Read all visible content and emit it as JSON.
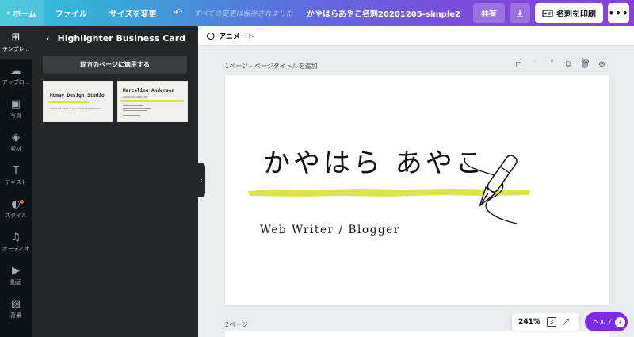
{
  "topbar": {
    "home": "ホーム",
    "file": "ファイル",
    "resize": "サイズを変更",
    "undo_icon": "undo-icon",
    "saved_status": "すべての変更は保存されました",
    "doc_name": "かやはらあやこ名刺20201205-simple2",
    "share": "共有",
    "download_icon": "download-icon",
    "print": "名刺を印刷",
    "more": "•••"
  },
  "rail": {
    "items": [
      {
        "label": "テンプレ...",
        "icon": "template-icon"
      },
      {
        "label": "アップロ...",
        "icon": "upload-icon"
      },
      {
        "label": "写真",
        "icon": "photo-icon"
      },
      {
        "label": "素材",
        "icon": "elements-icon"
      },
      {
        "label": "テキスト",
        "icon": "text-icon"
      },
      {
        "label": "スタイル",
        "icon": "style-icon"
      },
      {
        "label": "オーディオ",
        "icon": "audio-icon"
      },
      {
        "label": "動画",
        "icon": "video-icon"
      },
      {
        "label": "背景",
        "icon": "background-icon"
      }
    ]
  },
  "panel": {
    "back_icon": "back-chevron-icon",
    "title": "Highlighter Business Card",
    "apply_button": "両方のページに適用する",
    "thumbnails": [
      {
        "title": "Momay Design Studio",
        "sub": "CREATIVE DESIGN SOLUTION FOR BRANDS"
      },
      {
        "title": "Marceline Anderson",
        "sub": "CREATIVE DIRECTOR"
      }
    ]
  },
  "editor": {
    "animate": "アニメート",
    "page1_label": "1ページ - ページタイトルを追加",
    "page2_label": "2ページ"
  },
  "card": {
    "name": "かやはら あやこ",
    "subtitle": "Web Writer / Blogger",
    "highlight_color": "#dde34f"
  },
  "controls": {
    "zoom": "241%",
    "page_count": "3",
    "help": "ヘルプ",
    "help_icon": "?"
  },
  "colors": {
    "accent": "#7d2ae8",
    "rail_bg": "#0e1318",
    "panel_bg": "#252627"
  }
}
